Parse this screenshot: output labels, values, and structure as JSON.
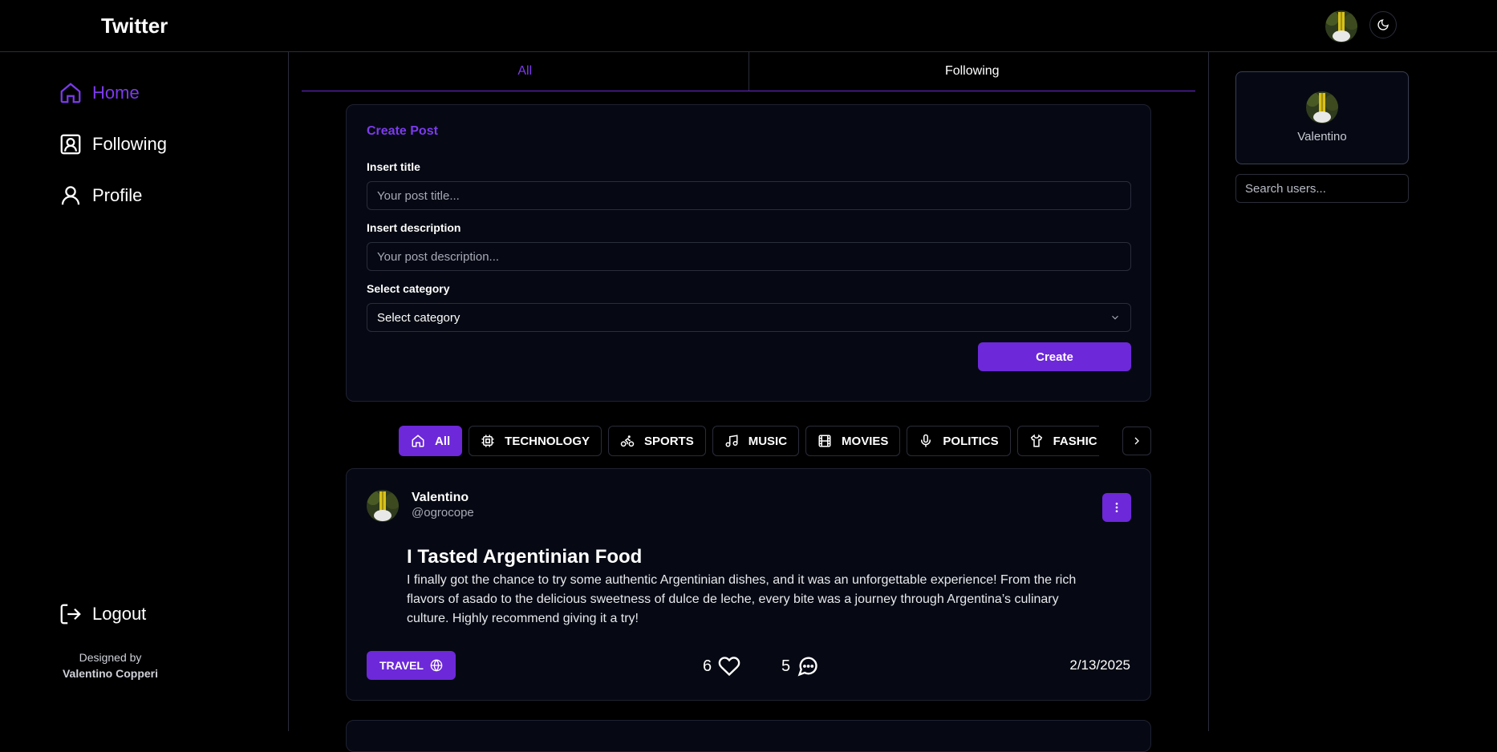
{
  "app": {
    "title": "Twitter"
  },
  "header": {
    "avatar_icon": "user-avatar",
    "theme_icon": "moon-icon"
  },
  "sidebar": {
    "items": [
      {
        "label": "Home",
        "icon": "home-icon",
        "active": true
      },
      {
        "label": "Following",
        "icon": "contact-icon"
      },
      {
        "label": "Profile",
        "icon": "user-icon"
      }
    ],
    "logout_label": "Logout",
    "designed_by": "Designed by",
    "designer": "Valentino Copperi"
  },
  "tabs": [
    {
      "label": "All",
      "active": true
    },
    {
      "label": "Following"
    }
  ],
  "create_post": {
    "title": "Create Post",
    "title_label": "Insert title",
    "title_placeholder": "Your post title...",
    "description_label": "Insert description",
    "description_placeholder": "Your post description...",
    "category_label": "Select category",
    "category_value": "Select category",
    "create_label": "Create"
  },
  "categories": [
    {
      "label": "All",
      "icon": "home-icon",
      "active": true
    },
    {
      "label": "TECHNOLOGY",
      "icon": "cpu-icon"
    },
    {
      "label": "SPORTS",
      "icon": "bike-icon"
    },
    {
      "label": "MUSIC",
      "icon": "music-icon"
    },
    {
      "label": "MOVIES",
      "icon": "film-icon"
    },
    {
      "label": "POLITICS",
      "icon": "mic-icon"
    },
    {
      "label": "FASHIC",
      "icon": "shirt-icon"
    }
  ],
  "post": {
    "author": "Valentino",
    "handle": "@ogrocope",
    "title": "I Tasted Argentinian Food",
    "description": "I finally got the chance to try some authentic Argentinian dishes, and it was an unforgettable experience! From the rich flavors of asado to the delicious sweetness of dulce de leche, every bite was a journey through Argentina’s culinary culture. Highly recommend giving it a try!",
    "tag": "TRAVEL",
    "likes": "6",
    "comments": "5",
    "date": "2/13/2025"
  },
  "right_rail": {
    "profile_name": "Valentino",
    "search_placeholder": "Search users..."
  },
  "colors": {
    "accent": "#6d28d9",
    "accent_text": "#7c3aed",
    "background": "#000000",
    "card": "#060913"
  }
}
